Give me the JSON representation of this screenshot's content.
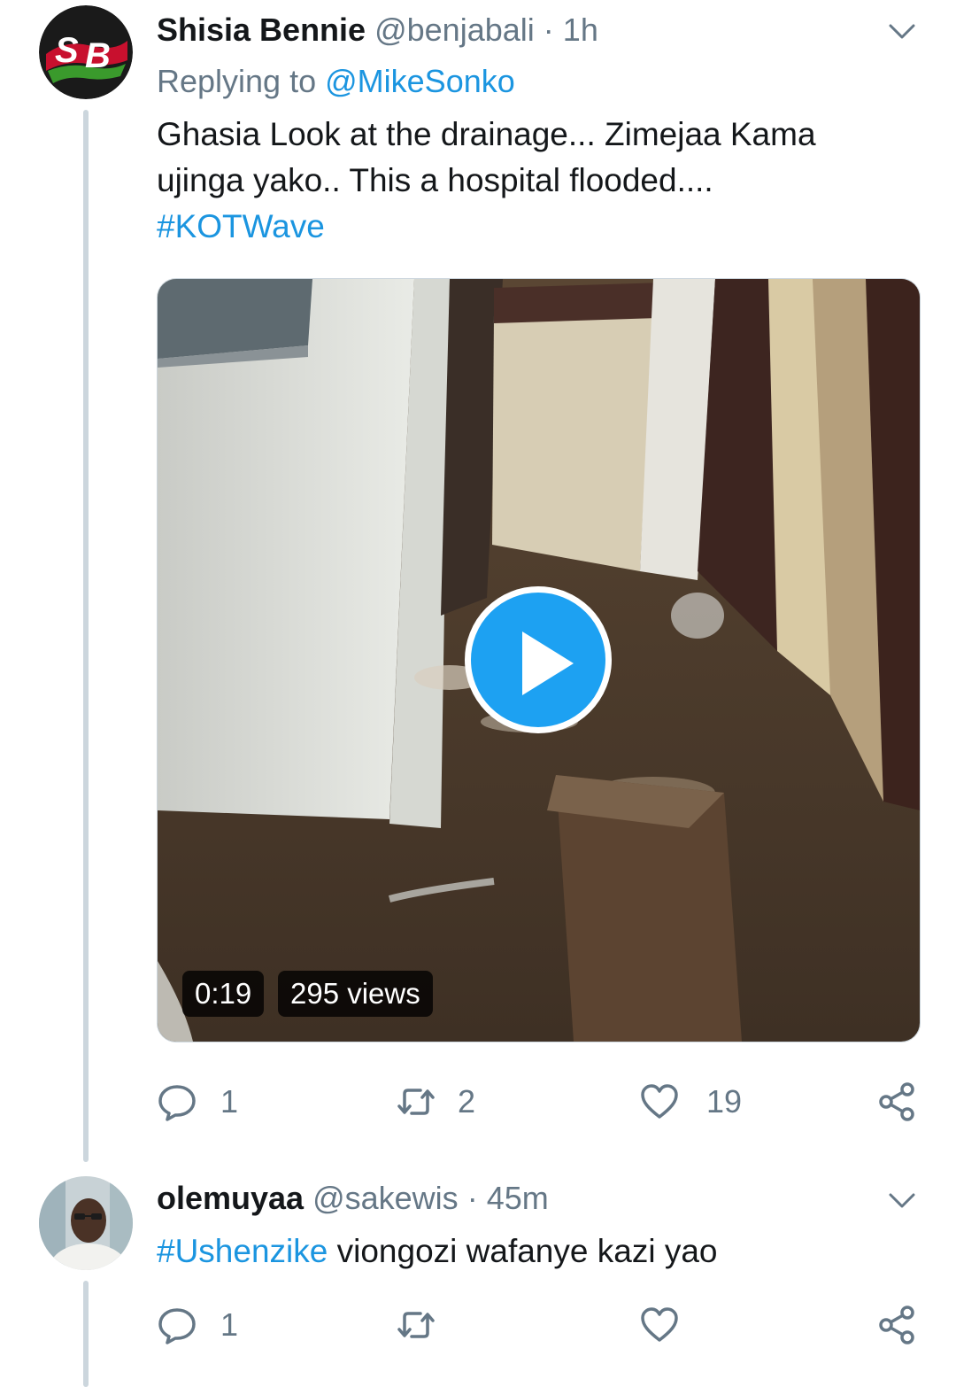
{
  "tweets": [
    {
      "name": "Shisia Bennie",
      "handle": "@benjabali",
      "separator": "·",
      "time": "1h",
      "avatar_icon": "sb-logo-icon",
      "replying_prefix": "Replying to",
      "replying_to": "@MikeSonko",
      "text_line1": "Ghasia Look at the drainage... Zimejaa Kama",
      "text_line2": "ujinga yako.. This a hospital flooded....",
      "hashtag": "#KOTWave",
      "video": {
        "duration": "0:19",
        "views": "295 views",
        "play_icon": "play-icon"
      },
      "reply_count": "1",
      "retweet_count": "2",
      "like_count": "19"
    },
    {
      "name": "olemuyaa",
      "handle": "@sakewis",
      "separator": "·",
      "time": "45m",
      "avatar_icon": "user-photo",
      "hashtag": "#Ushenzike",
      "text": "viongozi wafanye kazi yao",
      "reply_count": "1",
      "retweet_count": "",
      "like_count": ""
    }
  ],
  "colors": {
    "link": "#1b95e0",
    "secondary_text": "#657786",
    "play_button": "#1da1f2",
    "thread_line": "#ccd6dd"
  }
}
